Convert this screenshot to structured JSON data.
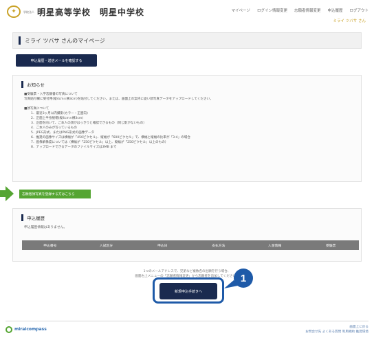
{
  "header": {
    "school_sub": "学校法人",
    "school_name": "明星高等学校　明星中学校",
    "nav": [
      "マイページ",
      "ログイン情報変更",
      "志願者情報変更",
      "申込履歴",
      "ログアウト"
    ],
    "user": "ミライ ツバサ さん"
  },
  "page_title": "ミライ ツバサ さんのマイページ",
  "confirm_button": "申込履歴・送信メールを確認する",
  "notice": {
    "heading": "お知らせ",
    "lines": [
      "■受験票・入学志願書の写真について",
      "写真貼付欄に受付用(縦4cm×横3cm)を貼付してください。または、画面上の案内に従い顔写真データをアップロードしてください。",
      "",
      "■顔写真について",
      "1．最近3ヶ月以内撮影(カラー・正面向)",
      "2．正面上半身脱帽(縦4cm×横3cm)",
      "3．正面を向いて、ご本人の顔がはっきりと確認できるもの（同じ影がないもの）",
      "4．ご本人のみが写っているもの",
      "5．JPEG形式、またはPNG形式の画像データ",
      "6．推奨の画像サイズは横幅が「450ピクセル」、縦幅が「600ピクセル」で、横幅と縦幅の比率が「3:4」の場合",
      "7．画像解像度については（横幅が「250ピクセル」以上、縦幅が「250ピクセル」以上のもの）",
      "8．アップロードできるデータのファイルサイズは3MB まで"
    ]
  },
  "photo_tab": "志願者顔写真を登録する方はこちら",
  "history": {
    "heading": "申込履歴",
    "empty": "申込履歴情報はありません。",
    "columns": [
      "申込番号",
      "入試区分",
      "申込日",
      "支払方法",
      "入金情報",
      "受験票"
    ]
  },
  "notes": [
    "1つのメールアドレスで、兄弟など複数名の出願を行う場合、",
    "画面右上メニューの「志願者情報変更」から志願者を追加してください。"
  ],
  "apply_button": "新規申込手続きへ",
  "callout_number": "1",
  "footer": {
    "logo": "miraicompass",
    "links": [
      "お問合せ先",
      "よくある質問",
      "利用規約",
      "推奨環境"
    ],
    "top": "画面上に戻る"
  },
  "colors": {
    "navy": "#1a2a4f",
    "green": "#55a532",
    "gold": "#c9a227",
    "callout": "#1e5aa8"
  }
}
